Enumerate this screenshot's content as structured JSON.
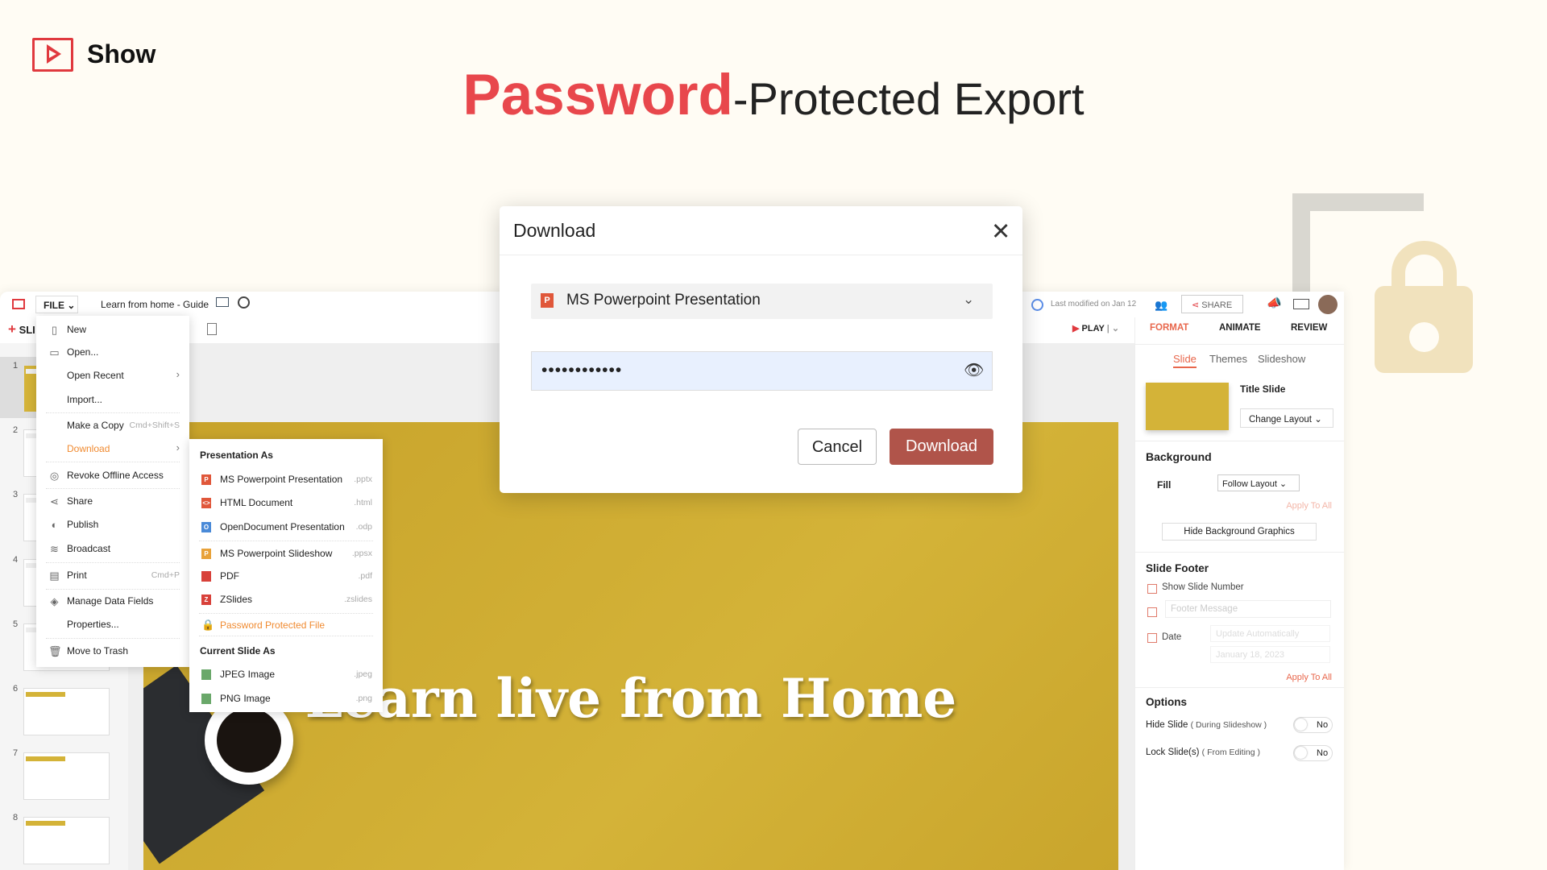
{
  "brand": {
    "name": "Show",
    "color": "#e0393e"
  },
  "headline": {
    "highlight": "Password",
    "rest": "-Protected Export",
    "highlight_color": "#e8474c"
  },
  "app": {
    "toolbar": {
      "file_label": "FILE",
      "doc_title": "Learn from home - Guide",
      "new_slide_label": "SLI",
      "last_modified": "Last modified on Jan 12",
      "share_label": "SHARE",
      "play_label": "PLAY"
    },
    "thumbnails": [
      "1",
      "2",
      "3",
      "4",
      "5",
      "6",
      "7",
      "8"
    ],
    "slide": {
      "title": "Learn live from Home",
      "bg_color": "#c9a52c"
    },
    "file_menu": [
      {
        "label": "New",
        "icon": "file-icon"
      },
      {
        "label": "Open...",
        "icon": "folder-icon"
      },
      {
        "label": "Open Recent",
        "submenu": true
      },
      {
        "label": "Import..."
      },
      {
        "label": "Make a Copy",
        "shortcut": "Cmd+Shift+S"
      },
      {
        "label": "Download",
        "submenu": true,
        "active": true
      },
      {
        "label": "Revoke Offline Access",
        "icon": "revoke-icon"
      },
      {
        "label": "Share",
        "icon": "share-icon"
      },
      {
        "label": "Publish",
        "icon": "globe-icon"
      },
      {
        "label": "Broadcast",
        "icon": "broadcast-icon"
      },
      {
        "label": "Print",
        "icon": "printer-icon",
        "shortcut": "Cmd+P"
      },
      {
        "label": "Manage Data Fields",
        "icon": "layers-icon"
      },
      {
        "label": "Properties..."
      },
      {
        "label": "Move to Trash",
        "icon": "trash-icon"
      }
    ],
    "download_menu": {
      "presentation_header": "Presentation As",
      "presentation": [
        {
          "label": "MS Powerpoint Presentation",
          "ext": ".pptx",
          "badge": "P",
          "color": "#e0573a"
        },
        {
          "label": "HTML Document",
          "ext": ".html",
          "badge": "<>",
          "color": "#e0573a"
        },
        {
          "label": "OpenDocument Presentation",
          "ext": ".odp",
          "badge": "O",
          "color": "#4a8ad8"
        },
        {
          "label": "MS Powerpoint Slideshow",
          "ext": ".ppsx",
          "badge": "P",
          "color": "#e8a23a"
        },
        {
          "label": "PDF",
          "ext": ".pdf",
          "badge": "PDF",
          "color": "#d8413a"
        },
        {
          "label": "ZSlides",
          "ext": ".zslides",
          "badge": "Z",
          "color": "#d8413a"
        }
      ],
      "password_item": "Password Protected File",
      "slide_header": "Current Slide As",
      "slide": [
        {
          "label": "JPEG Image",
          "ext": ".jpeg"
        },
        {
          "label": "PNG Image",
          "ext": ".png"
        }
      ]
    },
    "right_panel": {
      "tabs": [
        "FORMAT",
        "ANIMATE",
        "REVIEW"
      ],
      "subtabs": [
        "Slide",
        "Themes",
        "Slideshow"
      ],
      "layout_name": "Title Slide",
      "change_layout": "Change Layout",
      "background_heading": "Background",
      "fill_label": "Fill",
      "fill_value": "Follow Layout",
      "apply_all": "Apply To All",
      "hide_bg": "Hide Background Graphics",
      "footer_heading": "Slide Footer",
      "show_slide_number": "Show Slide Number",
      "footer_placeholder": "Footer Message",
      "date_label": "Date",
      "date_mode": "Update Automatically",
      "date_value": "January 18, 2023",
      "options_heading": "Options",
      "hide_slide": "Hide Slide",
      "hide_slide_note": "( During Slideshow )",
      "lock_slide": "Lock Slide(s)",
      "lock_slide_note": "( From Editing )",
      "toggle_value": "No"
    }
  },
  "dialog": {
    "title": "Download",
    "format": "MS Powerpoint Presentation",
    "password_value": "••••••••••••",
    "cancel": "Cancel",
    "download": "Download",
    "accent": "#b0544a"
  }
}
